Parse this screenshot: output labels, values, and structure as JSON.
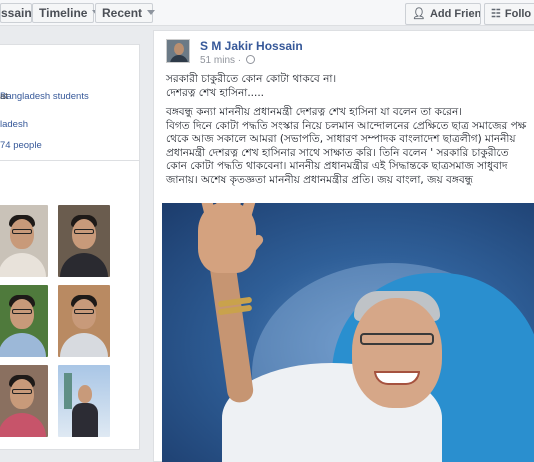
{
  "header": {
    "tab_reviews": "ssain",
    "tab_timeline": "Timeline",
    "tab_recent": "Recent",
    "add_friend": "Add Friend",
    "follow": "Follo"
  },
  "intro": {
    "line1_prefix": "at ",
    "line1_link": "Bangladesh students",
    "line2": "ladesh",
    "line3": "74 people"
  },
  "post": {
    "author": "S M Jakir Hossain",
    "time": "51 mins · ",
    "text_lines": [
      "সরকারী চাকুরীতে কোন কোটা থাকবে না।",
      "দেশরত্ন শেখ হাসিনা.....",
      "",
      "বঙ্গবন্ধু কন্যা মাননীয় প্রধানমন্ত্রী দেশরত্ন শেখ হাসিনা যা বলেন তা করেন।",
      "বিগত দিনে কোটা পদ্ধতি সংস্কার নিয়ে চলমান আন্দোলনের প্রেক্ষিতে ছাত্র সমাজের পক্ষ",
      "থেকে আজ সকালে আমরা (সভাপতি, সাধারণ সম্পাদক বাংলাদেশ ছাত্রলীগ) মাননীয়",
      "প্রধানমন্ত্রী দেশরত্ন শেখ হাসিনার সাথে সাক্ষাত করি। তিনি বলেন ' সরকারি চাকুরীতে",
      "কোন কোটা পদ্ধতি থাকবেনা। মাননীয় প্রধানমন্ত্রীর এই সিদ্ধান্তকে ছাত্রসমাজ সাধুবাদ",
      "জানায়। অশেষ কৃতজ্ঞতা মাননীয় প্রধানমন্ত্রীর প্রতি। জয় বাংলা, জয় বঙ্গবন্ধু"
    ]
  },
  "colors": {
    "link": "#365899",
    "page_bg": "#e9ebee"
  },
  "icons": {
    "add_friend": "person-plus-icon",
    "follow": "rss-icon",
    "privacy": "globe-icon"
  }
}
